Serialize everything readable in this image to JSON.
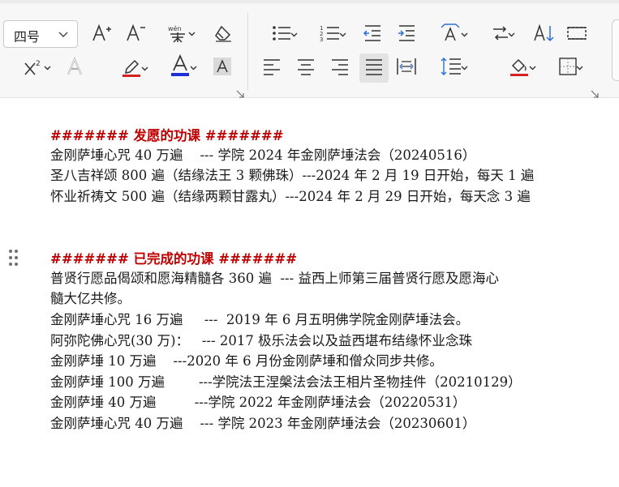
{
  "toolbar": {
    "font_size": "四号",
    "colors": {
      "font_color_bar": "#1f2fd6",
      "highlight_bar": "#d82020",
      "fill_bar": "#d82020",
      "icon": "#333333"
    },
    "icons": [
      "increase-font-icon",
      "decrease-font-icon",
      "phonetic-guide-icon",
      "clear-format-icon",
      "superscript-icon",
      "text-effect-icon",
      "highlight-icon",
      "font-color-icon",
      "char-shading-icon",
      "bullet-list-icon",
      "numbered-list-icon",
      "decrease-indent-icon",
      "increase-indent-icon",
      "text-direction-icon",
      "line-break-icon",
      "sort-icon",
      "border-box-icon",
      "align-left-icon",
      "align-center-icon",
      "align-right-icon",
      "justify-icon",
      "distribute-icon",
      "line-spacing-icon",
      "shading-icon",
      "borders-icon"
    ]
  },
  "document": {
    "section1": {
      "heading": "####### 发愿的功课 #######",
      "lines": [
        "金刚萨埵心咒 40 万遍    --- 学院 2024 年金刚萨埵法会（20240516）",
        "圣八吉祥颂 800 遍（结缘法王 3 颗佛珠）---2024 年 2 月 19 日开始，每天 1 遍",
        "怀业祈祷文 500 遍（结缘两颗甘露丸）---2024 年 2 月 29 日开始，每天念 3 遍"
      ]
    },
    "section2": {
      "heading": "####### 已完成的功课 #######",
      "lines": [
        "普贤行愿品偈颂和愿海精髓各 360 遍  --- 益西上师第三届普贤行愿及愿海心",
        "髓大亿共修。",
        "金刚萨埵心咒 16 万遍     ---  2019 年 6 月五明佛学院金刚萨埵法会。",
        "阿弥陀佛心咒(30 万)：   --- 2017 极乐法会以及益西堪布结缘怀业念珠",
        "金刚萨埵 10 万遍    ---2020 年 6 月份金刚萨埵和僧众同步共修。",
        "金刚萨埵 100 万遍        ---学院法王涅槃法会法王相片圣物挂件（20210129）",
        "金刚萨埵 40 万遍         ---学院 2022 年金刚萨埵法会（20220531）",
        "金刚萨埵心咒 40 万遍    --- 学院 2023 年金刚萨埵法会（20230601）"
      ]
    }
  }
}
